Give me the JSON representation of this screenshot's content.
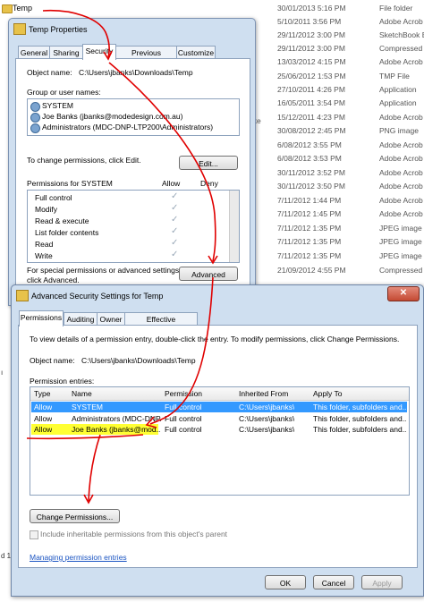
{
  "explorer": {
    "rows": [
      {
        "name": "Temp",
        "date": "30/01/2013 5:16 PM",
        "type": "File folder"
      },
      {
        "name": "",
        "date": "5/10/2011 3:56 PM",
        "type": "Adobe Acrob"
      },
      {
        "name": "",
        "date": "29/11/2012 3:00 PM",
        "type": "SketchBook E"
      },
      {
        "name": "",
        "date": "29/11/2012 3:00 PM",
        "type": "Compressed"
      },
      {
        "name": "",
        "date": "13/03/2012 4:15 PM",
        "type": "Adobe Acrob"
      },
      {
        "name": "",
        "date": "25/06/2012 1:53 PM",
        "type": "TMP File"
      },
      {
        "name": "",
        "date": "27/10/2011 4:26 PM",
        "type": "Application"
      },
      {
        "name": "",
        "date": "16/05/2011 3:54 PM",
        "type": "Application"
      },
      {
        "name": "",
        "date": "15/12/2011 4:23 PM",
        "type": "Adobe Acrob"
      },
      {
        "name": "",
        "date": "30/08/2012 2:45 PM",
        "type": "PNG image"
      },
      {
        "name": "",
        "date": "6/08/2012 3:55 PM",
        "type": "Adobe Acrob"
      },
      {
        "name": "",
        "date": "6/08/2012 3:53 PM",
        "type": "Adobe Acrob"
      },
      {
        "name": "",
        "date": "30/11/2012 3:52 PM",
        "type": "Adobe Acrob"
      },
      {
        "name": "",
        "date": "30/11/2012 3:50 PM",
        "type": "Adobe Acrob"
      },
      {
        "name": "",
        "date": "7/11/2012 1:44 PM",
        "type": "Adobe Acrob"
      },
      {
        "name": "",
        "date": "7/11/2012 1:45 PM",
        "type": "Adobe Acrob"
      },
      {
        "name": "",
        "date": "7/11/2012 1:35 PM",
        "type": "JPEG image"
      },
      {
        "name": "",
        "date": "7/11/2012 1:35 PM",
        "type": "JPEG image"
      },
      {
        "name": "",
        "date": "7/11/2012 1:35 PM",
        "type": "JPEG image"
      },
      {
        "name": "",
        "date": "21/09/2012 4:55 PM",
        "type": "Compressed"
      }
    ],
    "exe_fragment": "exe",
    "left_fragment_1": "ı",
    "left_fragment_2": "d 1"
  },
  "props": {
    "title": "Temp Properties",
    "tabs": [
      "General",
      "Sharing",
      "Security",
      "Previous Versions",
      "Customize"
    ],
    "object_name_label": "Object name:",
    "object_name_value": "C:\\Users\\jbanks\\Downloads\\Temp",
    "groups_label": "Group or user names:",
    "users": [
      "SYSTEM",
      "Joe Banks (jbanks@modedesign.com.au)",
      "Administrators (MDC-DNP-LTP200\\Administrators)"
    ],
    "change_perm_text": "To change permissions, click Edit.",
    "edit_button": "Edit...",
    "perm_for": "Permissions for SYSTEM",
    "allow": "Allow",
    "deny": "Deny",
    "permissions": [
      "Full control",
      "Modify",
      "Read & execute",
      "List folder contents",
      "Read",
      "Write"
    ],
    "special_text_1": "For special permissions or advanced settings,",
    "special_text_2": "click Advanced.",
    "advanced_button": "Advanced"
  },
  "adv": {
    "title": "Advanced Security Settings for Temp",
    "close_glyph": "✕",
    "tabs": [
      "Permissions",
      "Auditing",
      "Owner",
      "Effective Permissions"
    ],
    "instructions": "To view details of a permission entry, double-click the entry. To modify permissions, click Change Permissions.",
    "object_name_label": "Object name:",
    "object_name_value": "C:\\Users\\jbanks\\Downloads\\Temp",
    "entries_label": "Permission entries:",
    "columns": [
      "Type",
      "Name",
      "Permission",
      "Inherited From",
      "Apply To"
    ],
    "entries": [
      {
        "type": "Allow",
        "name": "SYSTEM",
        "permission": "Full control",
        "inherited": "C:\\Users\\jbanks\\",
        "apply": "This folder, subfolders and..."
      },
      {
        "type": "Allow",
        "name": "Administrators (MDC-DNP...",
        "permission": "Full control",
        "inherited": "C:\\Users\\jbanks\\",
        "apply": "This folder, subfolders and..."
      },
      {
        "type": "Allow",
        "name": "Joe Banks (jbanks@mod...",
        "permission": "Full control",
        "inherited": "C:\\Users\\jbanks\\",
        "apply": "This folder, subfolders and..."
      }
    ],
    "change_button": "Change Permissions...",
    "include_inheritable": "Include inheritable permissions from this object's parent",
    "manage_link": "Managing permission entries",
    "ok": "OK",
    "cancel": "Cancel",
    "apply": "Apply"
  },
  "colors": {
    "selection": "#3399ff",
    "highlight": "#ffff33",
    "annotation": "#e00000"
  }
}
